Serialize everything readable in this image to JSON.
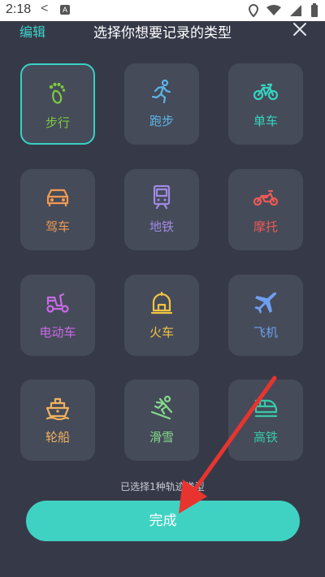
{
  "status_bar": {
    "time": "2:18"
  },
  "header": {
    "edit_label": "编辑",
    "title": "选择你想要记录的类型"
  },
  "tiles": [
    {
      "label": "步行",
      "icon": "footprint-icon",
      "color": "#7cc943",
      "selected": true
    },
    {
      "label": "跑步",
      "icon": "running-icon",
      "color": "#5eb4e8",
      "selected": false
    },
    {
      "label": "单车",
      "icon": "bicycle-icon",
      "color": "#36d3bf",
      "selected": false
    },
    {
      "label": "驾车",
      "icon": "car-icon",
      "color": "#f09a52",
      "selected": false
    },
    {
      "label": "地铁",
      "icon": "subway-icon",
      "color": "#a08ae3",
      "selected": false
    },
    {
      "label": "摩托",
      "icon": "motorcycle-icon",
      "color": "#ee5a56",
      "selected": false
    },
    {
      "label": "电动车",
      "icon": "scooter-icon",
      "color": "#c96ae6",
      "selected": false
    },
    {
      "label": "火车",
      "icon": "train-icon",
      "color": "#f0c442",
      "selected": false
    },
    {
      "label": "飞机",
      "icon": "airplane-icon",
      "color": "#6f9ff0",
      "selected": false
    },
    {
      "label": "轮船",
      "icon": "ship-icon",
      "color": "#f2b25e",
      "selected": false
    },
    {
      "label": "滑雪",
      "icon": "skiing-icon",
      "color": "#84d98c",
      "selected": false
    },
    {
      "label": "高铁",
      "icon": "high-speed-rail-icon",
      "color": "#36c9a7",
      "selected": false
    }
  ],
  "hint": "已选择1种轨迹类型",
  "done_label": "完成",
  "colors": {
    "background": "#363a48",
    "tile": "#454b59",
    "accent": "#37d1c4",
    "arrow": "#e8342f"
  }
}
